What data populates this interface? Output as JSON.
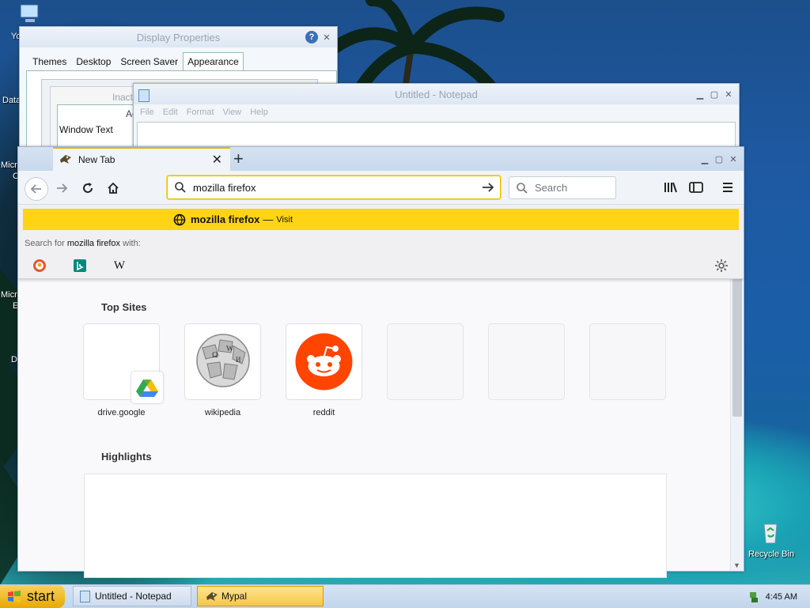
{
  "desktop": {
    "left_labels": [
      "Yo",
      "Data",
      "Micr",
      "C",
      "Micr",
      "E",
      "D"
    ],
    "recycle_bin_label": "Recycle Bin"
  },
  "display_properties": {
    "title": "Display Properties",
    "tabs": [
      "Themes",
      "Desktop",
      "Screen Saver",
      "Appearance"
    ],
    "active_tab": "Appearance",
    "preview": {
      "inactive_label": "Inact",
      "active_label": "Ac",
      "window_text_label": "Window Text"
    }
  },
  "notepad": {
    "title": "Untitled - Notepad",
    "menu": [
      "File",
      "Edit",
      "Format",
      "View",
      "Help"
    ]
  },
  "browser": {
    "tab_title": "New Tab",
    "url_value": "mozilla firefox",
    "search_placeholder": "Search",
    "suggestion": {
      "text": "mozilla firefox",
      "dash": "—",
      "action": "Visit"
    },
    "search_for_prefix": "Search for",
    "search_for_query": "mozilla firefox",
    "search_for_suffix": "with:",
    "engines": [
      "duckduckgo-icon",
      "bing-icon",
      "wikipedia-icon"
    ],
    "top_sites_heading": "Top Sites",
    "top_sites": [
      {
        "label": "drive.google"
      },
      {
        "label": "wikipedia"
      },
      {
        "label": "reddit"
      }
    ],
    "highlights_heading": "Highlights",
    "accent_color": "#ffd414"
  },
  "taskbar": {
    "start_label": "start",
    "items": [
      {
        "label": "Untitled - Notepad"
      },
      {
        "label": "Mypal"
      }
    ],
    "clock": "4:45 AM"
  }
}
